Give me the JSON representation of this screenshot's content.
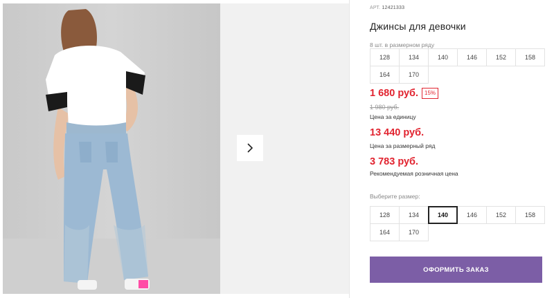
{
  "gallery": {
    "photo_alt": "photo-girl-in-jeans",
    "next_icon": "chevron-right-icon"
  },
  "product": {
    "article_label": "АРТ.",
    "article_number": "12421333",
    "title": "Джинсы для девочки",
    "pack_note": "8 шт. в размерном ряду",
    "pack_sizes": [
      "128",
      "134",
      "140",
      "146",
      "152",
      "158",
      "164",
      "170"
    ]
  },
  "pricing": {
    "unit_price": "1 680 руб.",
    "discount": "15%",
    "old_price": "1 980 руб.",
    "unit_label": "Цена за единицу",
    "pack_price": "13 440 руб.",
    "pack_label": "Цена за размерный ряд",
    "rrp_price": "3 783 руб.",
    "rrp_label": "Рекомендуемая розничная цена"
  },
  "size_picker": {
    "label": "Выберите размер:",
    "sizes": [
      "128",
      "134",
      "140",
      "146",
      "152",
      "158",
      "164",
      "170"
    ],
    "selected": "140"
  },
  "actions": {
    "order_label": "ОФОРМИТЬ ЗАКАЗ"
  },
  "colors": {
    "price_red": "#e1232f",
    "button_purple": "#7c5ea6"
  }
}
